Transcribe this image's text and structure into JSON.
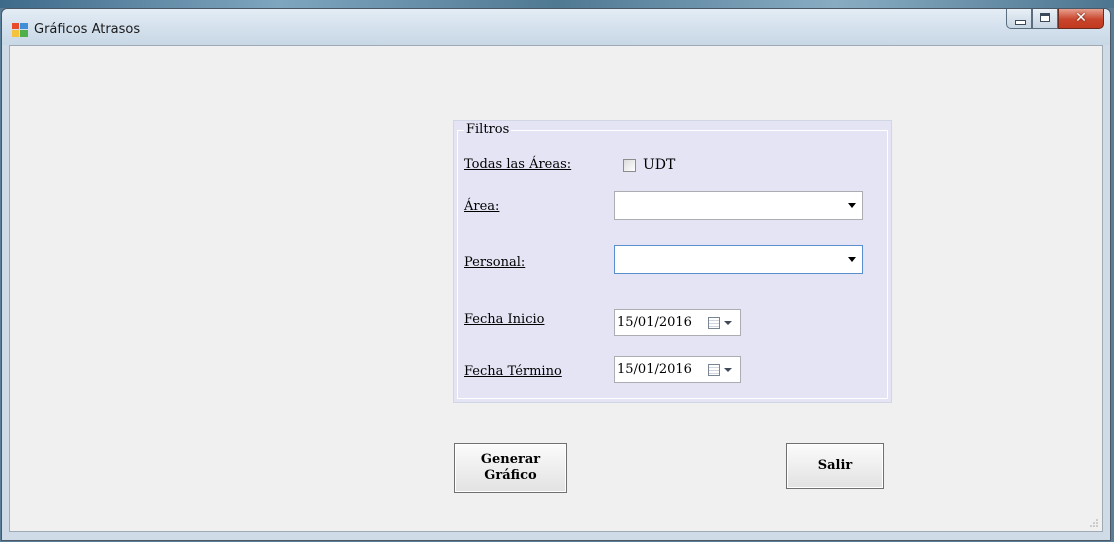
{
  "window": {
    "title": "Gráficos Atrasos"
  },
  "filters": {
    "legend": "Filtros",
    "todas_areas_label": "Todas las Áreas:",
    "udt_checkbox_label": "UDT",
    "udt_checked": false,
    "area_label": "Área:",
    "area_value": "",
    "personal_label": "Personal:",
    "personal_value": "",
    "fecha_inicio_label": "Fecha Inicio",
    "fecha_inicio_value": "15/01/2016",
    "fecha_termino_label": "Fecha Término",
    "fecha_termino_value": "15/01/2016"
  },
  "buttons": {
    "generar_line1": "Generar",
    "generar_line2": "Gráfico",
    "salir": "Salir"
  },
  "icons": {
    "app": "form-window-icon",
    "minimize": "minimize-icon",
    "maximize": "maximize-icon",
    "close": "close-icon",
    "calendar": "calendar-icon",
    "dropdown": "chevron-down-icon"
  },
  "colors": {
    "close_button": "#c8452c",
    "groupbox_bg": "#e4e4f5",
    "client_bg": "#f0f0f0"
  }
}
